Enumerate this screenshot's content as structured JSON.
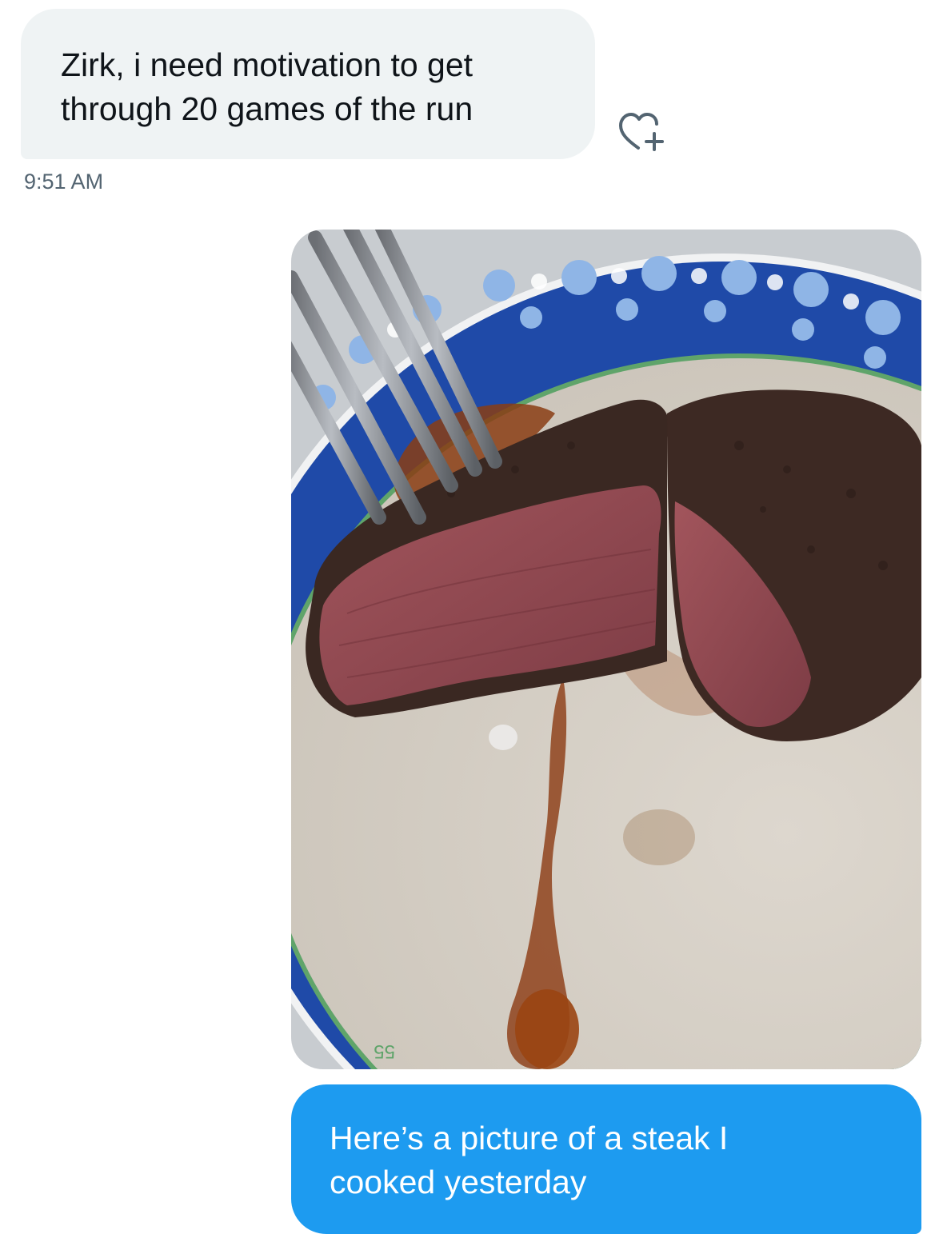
{
  "conversation": {
    "incoming_message": {
      "text": "Zirk, i need motivation to get\nthrough 20 games of the run",
      "timestamp": "9:51 AM",
      "reaction_icon": "heart-add-icon"
    },
    "outgoing_photo": {
      "plate_print_text": "55"
    },
    "outgoing_message": {
      "text": "Here’s a picture of a steak I\ncooked yesterday"
    }
  },
  "colors": {
    "incoming_bubble": "#eff3f4",
    "outgoing_bubble": "#1d9bf0",
    "timestamp": "#536471",
    "text_dark": "#0f1419"
  }
}
